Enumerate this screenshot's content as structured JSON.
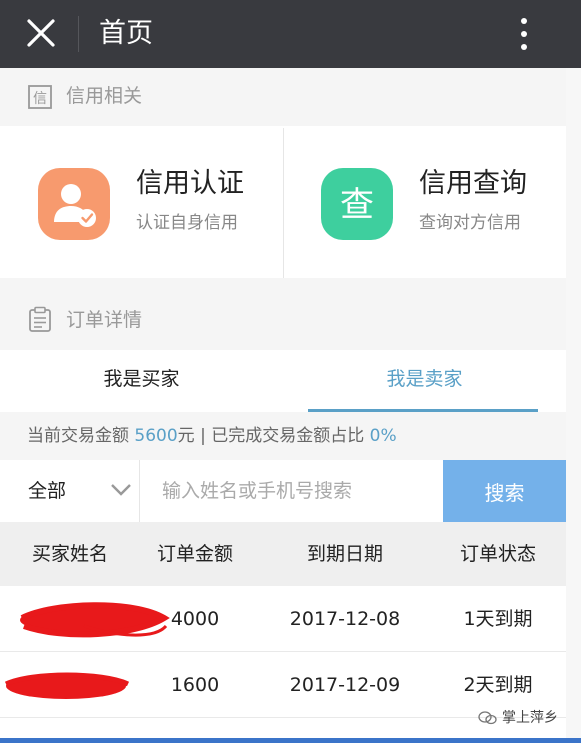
{
  "topbar": {
    "title": "首页",
    "close_icon": "close-icon",
    "more_icon": "more-vertical-icon"
  },
  "credit_section": {
    "label": "信用相关",
    "icon": "credit-doc-icon"
  },
  "cards": [
    {
      "title": "信用认证",
      "subtitle": "认证自身信用",
      "icon": "user-verified-icon",
      "color": "#f79a6e"
    },
    {
      "title": "信用查询",
      "subtitle": "查询对方信用",
      "icon": "query-cha-icon",
      "color": "#3ecf9e",
      "glyph": "查"
    }
  ],
  "order_section": {
    "label": "订单详情",
    "icon": "clipboard-icon"
  },
  "tabs": [
    {
      "label": "我是买家",
      "active": false
    },
    {
      "label": "我是卖家",
      "active": true
    }
  ],
  "summary": {
    "prefix": "当前交易金额 ",
    "amount": "5600",
    "mid": "元 | 已完成交易金额占比 ",
    "ratio": "0%"
  },
  "search": {
    "filter_value": "全部",
    "placeholder": "输入姓名或手机号搜索",
    "button_label": "搜索"
  },
  "table": {
    "headers": [
      "买家姓名",
      "订单金额",
      "到期日期",
      "订单状态"
    ],
    "rows": [
      {
        "name": "",
        "amount": "4000",
        "due": "2017-12-08",
        "status": "1天到期"
      },
      {
        "name": "",
        "amount": "1600",
        "due": "2017-12-09",
        "status": "2天到期"
      }
    ]
  },
  "colors": {
    "accent": "#5aa0c7",
    "search_button": "#74b1ea",
    "topbar": "#393a3f",
    "redaction": "#e8191b"
  },
  "watermark": {
    "text": "掌上萍乡",
    "icon": "wechat-icon"
  }
}
